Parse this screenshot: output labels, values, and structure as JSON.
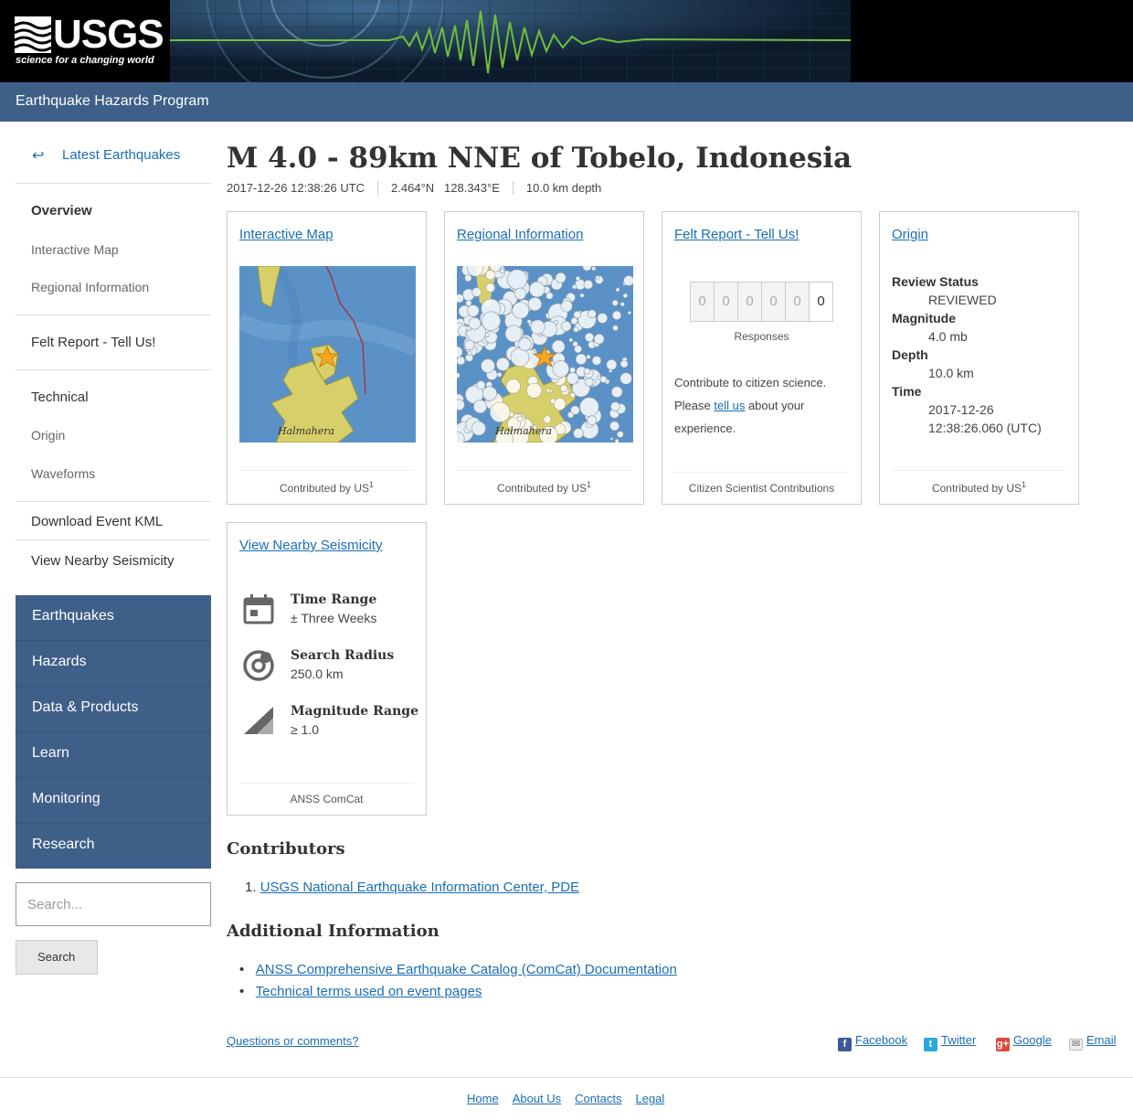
{
  "header": {
    "logo_text": "USGS",
    "tagline": "science for a changing world",
    "program": "Earthquake Hazards Program"
  },
  "sidebar": {
    "back_label": "Latest Earthquakes",
    "overview": "Overview",
    "interactive_map": "Interactive Map",
    "regional_information": "Regional Information",
    "felt_report": "Felt Report - Tell Us!",
    "technical": "Technical",
    "origin": "Origin",
    "waveforms": "Waveforms",
    "download_kml": "Download Event KML",
    "nearby": "View Nearby Seismicity",
    "site_nav": [
      "Earthquakes",
      "Hazards",
      "Data & Products",
      "Learn",
      "Monitoring",
      "Research"
    ],
    "search_placeholder": "Search...",
    "search_button": "Search"
  },
  "event": {
    "title": "M 4.0 - 89km NNE of Tobelo, Indonesia",
    "time": "2017-12-26 12:38:26 UTC",
    "lat": "2.464°N",
    "lon": "128.343°E",
    "depth": "10.0 km depth"
  },
  "cards": {
    "interactive_map": {
      "title": "Interactive Map",
      "map_label": "Halmahera",
      "footer": "Contributed by US",
      "sup": "1"
    },
    "regional": {
      "title": "Regional Information",
      "map_label": "Halmahera",
      "footer": "Contributed by US",
      "sup": "1"
    },
    "felt": {
      "title": "Felt Report - Tell Us!",
      "digits": [
        "0",
        "0",
        "0",
        "0",
        "0",
        "0"
      ],
      "responses": "Responses",
      "text1": "Contribute to citizen science.",
      "text2a": "Please ",
      "text2link": "tell us",
      "text2b": " about your",
      "text3": "experience.",
      "footer": "Citizen Scientist Contributions"
    },
    "origin": {
      "title": "Origin",
      "review_label": "Review Status",
      "review_value": "REVIEWED",
      "mag_label": "Magnitude",
      "mag_value": "4.0 mb",
      "depth_label": "Depth",
      "depth_value": "10.0 km",
      "time_label": "Time",
      "time_date": "2017-12-26",
      "time_clock": "12:38:26.060 (UTC)",
      "footer": "Contributed by US",
      "sup": "1"
    },
    "seismicity": {
      "title": "View Nearby Seismicity",
      "time_label": "Time Range",
      "time_value": "± Three Weeks",
      "radius_label": "Search Radius",
      "radius_value": "250.0 km",
      "mag_label": "Magnitude Range",
      "mag_value": "≥ 1.0",
      "footer": "ANSS ComCat"
    }
  },
  "contributors": {
    "heading": "Contributors",
    "items": [
      "USGS National Earthquake Information Center, PDE"
    ]
  },
  "additional": {
    "heading": "Additional Information",
    "items": [
      "ANSS Comprehensive Earthquake Catalog (ComCat) Documentation",
      "Technical terms used on event pages"
    ]
  },
  "bottom": {
    "questions": "Questions or comments?",
    "share": [
      "Facebook",
      "Twitter",
      "Google",
      "Email"
    ]
  },
  "footer": {
    "links": [
      "Home",
      "About Us",
      "Contacts",
      "Legal"
    ]
  },
  "colors": {
    "nav_blue": "#3e5f88",
    "link_blue": "#1a6eb5",
    "land_yellow": "#d7cf6a",
    "sea_blue": "#5a92c8"
  }
}
